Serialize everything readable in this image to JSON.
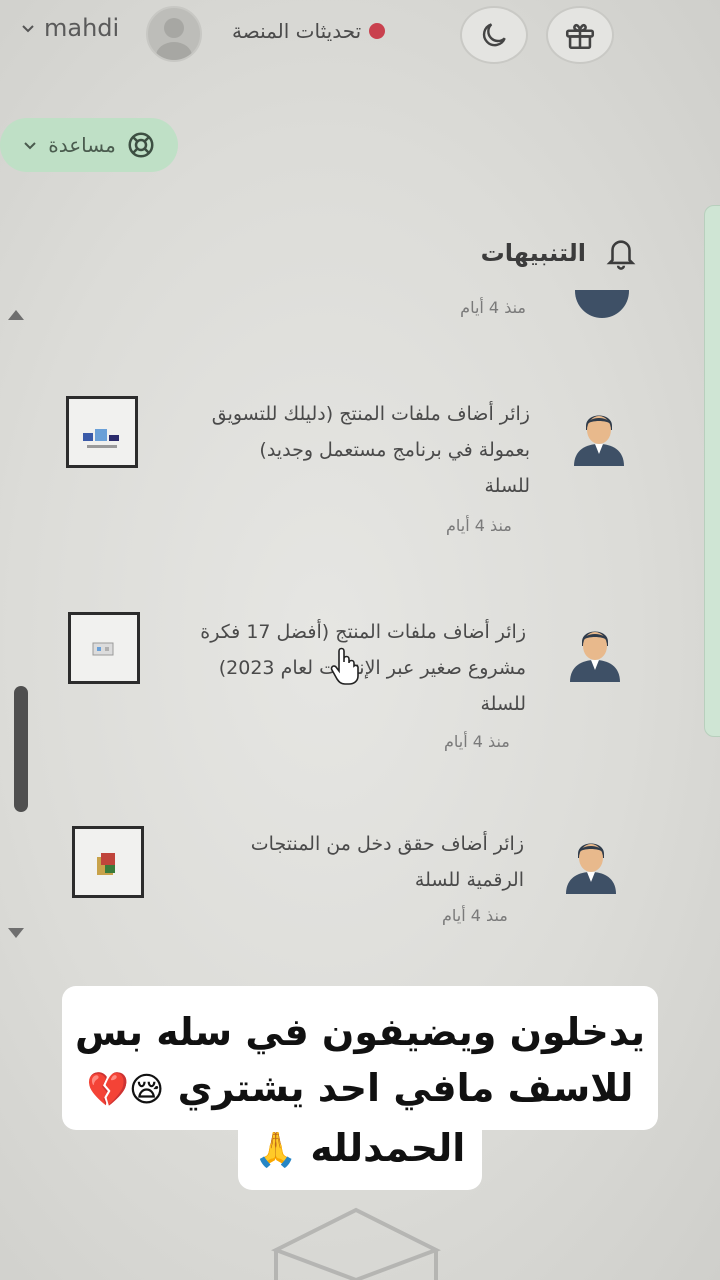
{
  "topbar": {
    "username": "mahdi",
    "updates_label": "تحديثات المنصة",
    "help_label": "مساعدة"
  },
  "notifications": {
    "title": "التنبيهات",
    "top_partial_time": "منذ 4 أيام",
    "items": [
      {
        "text": "زائر أضاف ملفات المنتج (دليلك للتسويق بعمولة في برنامج مستعمل وجديد) للسلة",
        "line1": "زائر أضاف ملفات المنتج (دليلك للتسويق",
        "line2": "بعمولة في برنامج مستعمل وجديد)",
        "line3": "للسلة",
        "time": "منذ 4 أيام"
      },
      {
        "text": "زائر أضاف ملفات المنتج (أفضل 17 فكرة مشروع صغير عبر الإنترنت لعام 2023) للسلة",
        "line1": "زائر أضاف ملفات المنتج (أفضل 17 فكرة",
        "line2": "مشروع صغير عبر الإنترنت لعام 2023)",
        "line3": "للسلة",
        "time": "منذ 4 أيام"
      },
      {
        "text": "زائر أضاف حقق دخل من المنتجات الرقمية للسلة",
        "line1": "زائر أضاف حقق دخل من المنتجات",
        "line2": "الرقمية للسلة",
        "time": "منذ 4 أيام"
      }
    ]
  },
  "caption": {
    "line1": "يدخلون ويضيفون في سله بس",
    "line2": "للاسف مافي احد يشتري",
    "line2_emojis": "😪💔",
    "line3": "الحمدلله",
    "line3_emoji": "🙏"
  },
  "colors": {
    "help_pill": "#bfe0c6",
    "red_dot": "#c9414e",
    "avatar_suit": "#3e5066"
  },
  "icons": [
    "gift-icon",
    "moon-icon",
    "user-avatar-icon",
    "chevron-down-icon",
    "lifebuoy-icon",
    "bell-icon",
    "person-avatar-icon",
    "hand-cursor-icon"
  ]
}
